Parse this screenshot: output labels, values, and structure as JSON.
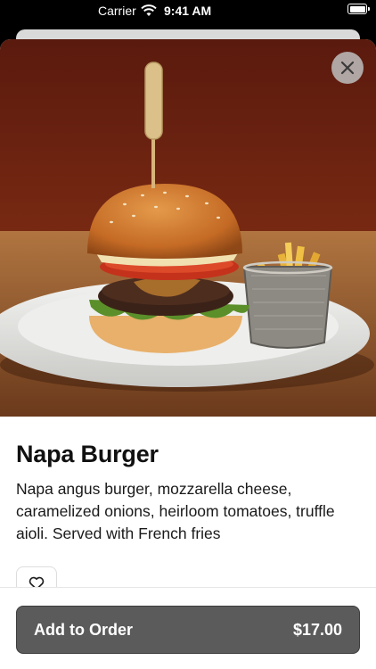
{
  "status_bar": {
    "carrier": "Carrier",
    "time": "9:41 AM"
  },
  "item": {
    "name": "Napa Burger",
    "description": "Napa angus burger, mozzarella cheese, caramelized onions, heirloom tomatoes, truffle aioli. Served with French fries",
    "image_icon": "burger-photo"
  },
  "actions": {
    "close_icon": "close-icon",
    "favorite_icon": "heart-icon",
    "order_label": "Add to Order",
    "order_price": "$17.00"
  },
  "colors": {
    "button_bg": "#5b5b5b",
    "text": "#111111"
  }
}
